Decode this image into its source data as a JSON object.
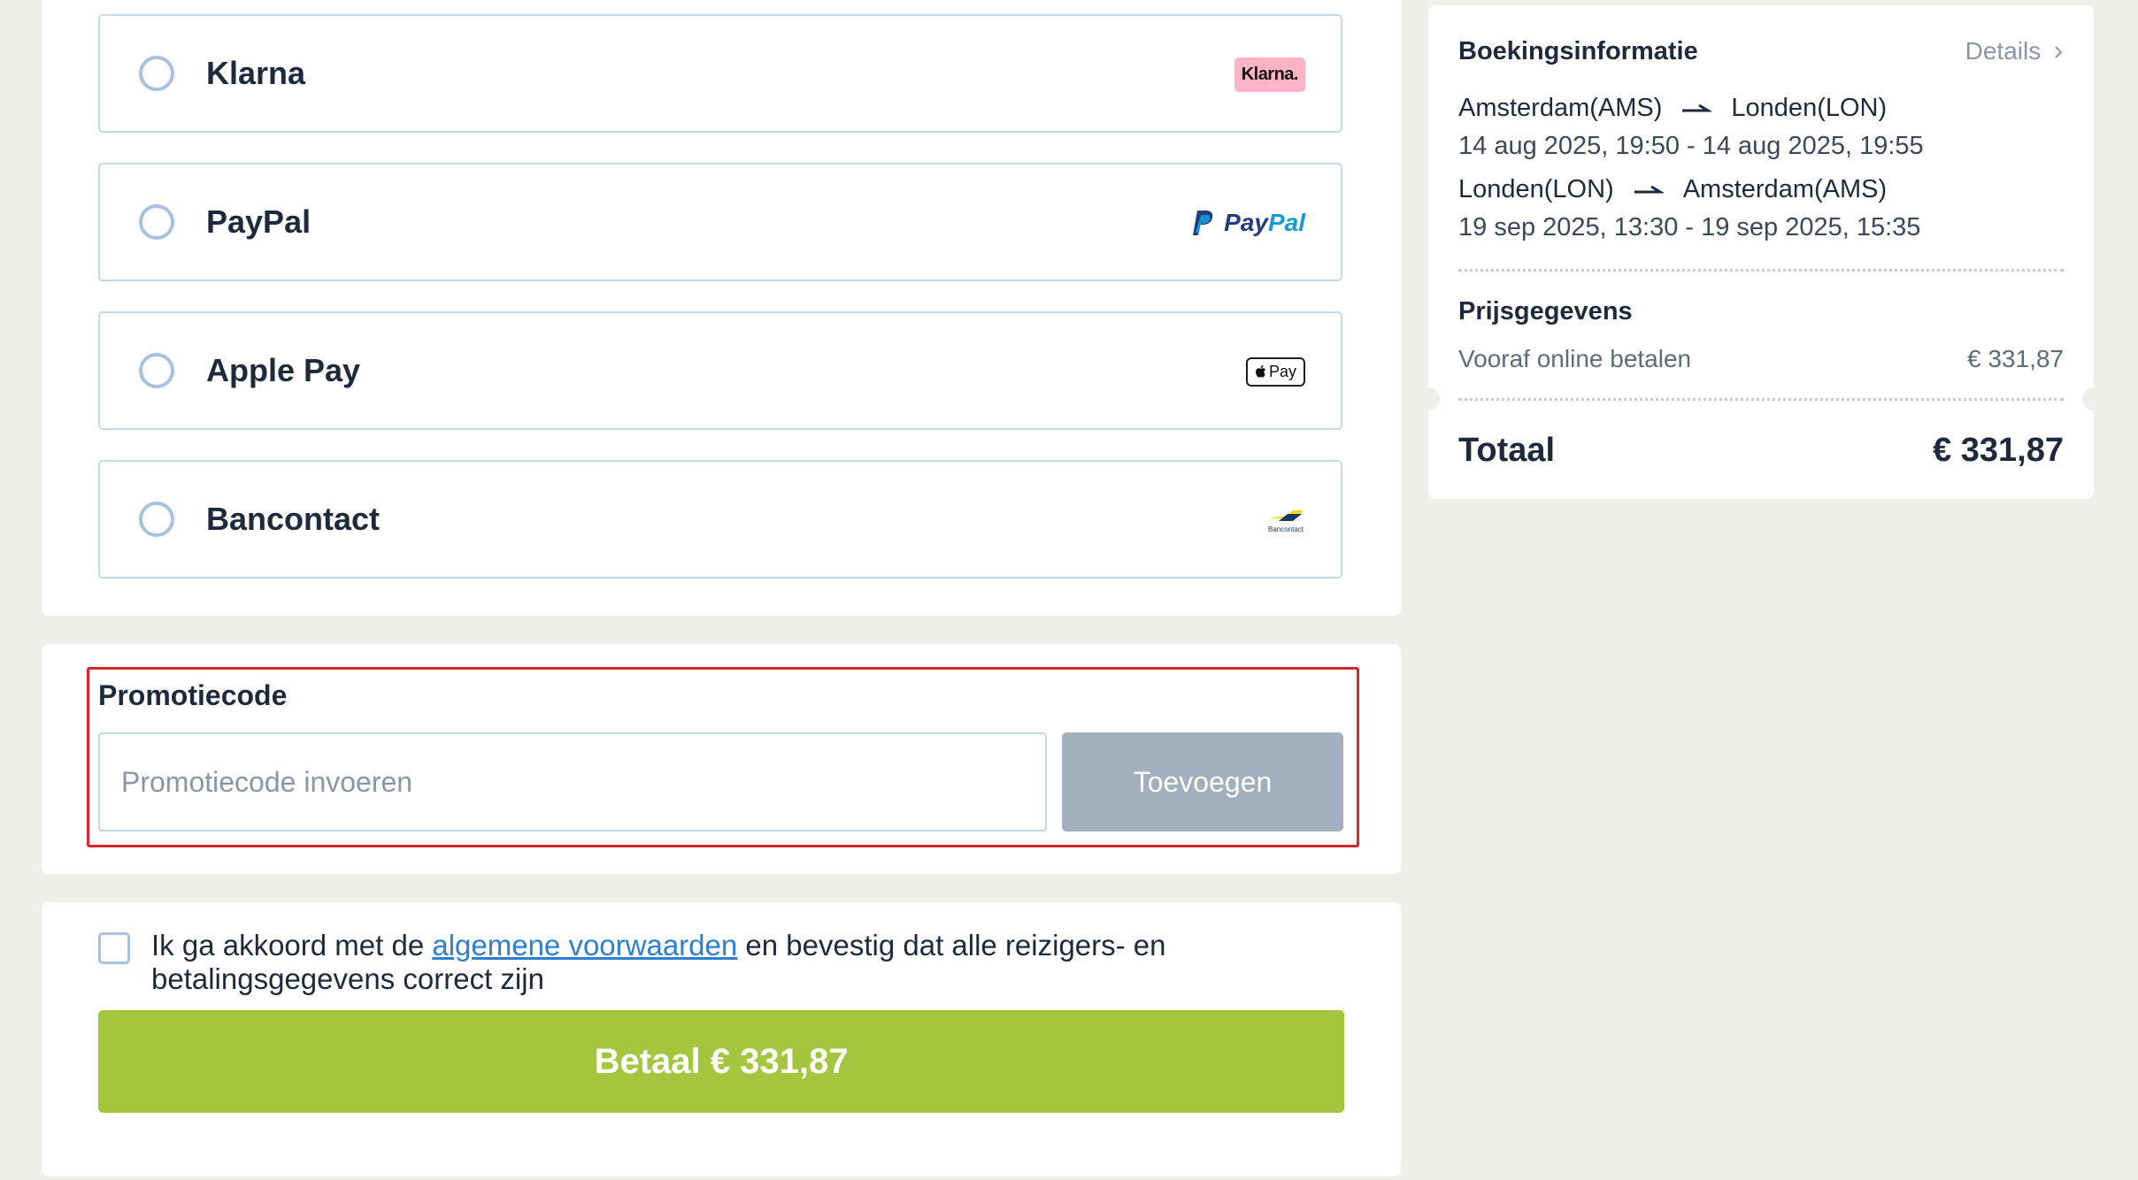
{
  "payment_methods": [
    {
      "label": "Klarna",
      "logo_text": "Klarna.",
      "logo_icon": "klarna-logo"
    },
    {
      "label": "PayPal",
      "logo_text": "PayPal",
      "logo_icon": "paypal-logo"
    },
    {
      "label": "Apple Pay",
      "logo_text": "Pay",
      "logo_icon": "apple-pay-logo"
    },
    {
      "label": "Bancontact",
      "logo_text": "Bancontact",
      "logo_icon": "bancontact-logo"
    }
  ],
  "promo": {
    "title": "Promotiecode",
    "placeholder": "Promotiecode invoeren",
    "button_label": "Toevoegen"
  },
  "terms": {
    "text_before": "Ik ga akkoord met de ",
    "link_text": "algemene voorwaarden",
    "text_after": " en bevestig dat alle reizigers- en betalingsgegevens correct zijn"
  },
  "pay_button_label": "Betaal € 331,87",
  "booking": {
    "title": "Boekingsinformatie",
    "details_label": "Details",
    "routes": [
      {
        "from": "Amsterdam(AMS)",
        "to": "Londen(LON)",
        "time": "14 aug 2025, 19:50 - 14 aug 2025, 19:55"
      },
      {
        "from": "Londen(LON)",
        "to": "Amsterdam(AMS)",
        "time": "19 sep 2025, 13:30 - 19 sep 2025, 15:35"
      }
    ],
    "price_title": "Prijsgegevens",
    "price_label": "Vooraf online betalen",
    "price_value": "€ 331,87",
    "total_label": "Totaal",
    "total_value": "€ 331,87"
  },
  "colors": {
    "background": "#efeee9",
    "accent_green": "#a4c63e",
    "highlight_red": "#d8262e",
    "link_blue": "#2f7fd1"
  }
}
